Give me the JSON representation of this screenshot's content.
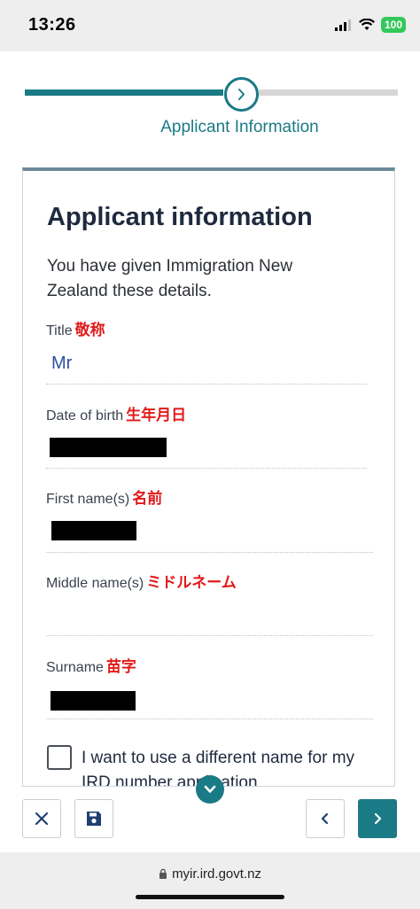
{
  "status_bar": {
    "time": "13:26",
    "battery": "100"
  },
  "progress": {
    "current_step_label": "Applicant Information",
    "accent_color": "#1a7a85"
  },
  "card": {
    "title": "Applicant information",
    "intro": "You have given Immigration New Zealand these details.",
    "fields": [
      {
        "label": "Title",
        "jp": "敬称",
        "value": "Mr"
      },
      {
        "label": "Date of birth",
        "jp": "生年月日",
        "value": ""
      },
      {
        "label": "First name(s)",
        "jp": "名前",
        "value": ""
      },
      {
        "label": "Middle name(s)",
        "jp": "ミドルネーム",
        "value": ""
      },
      {
        "label": "Surname",
        "jp": "苗字",
        "value": ""
      }
    ],
    "checkbox_label": "I want to use a different name for my IRD number application",
    "checkbox_checked": false
  },
  "toolbar": {
    "icons": [
      "close-icon",
      "save-icon",
      "chevron-left-icon",
      "chevron-right-icon"
    ]
  },
  "browser": {
    "url": "myir.ird.govt.nz"
  }
}
